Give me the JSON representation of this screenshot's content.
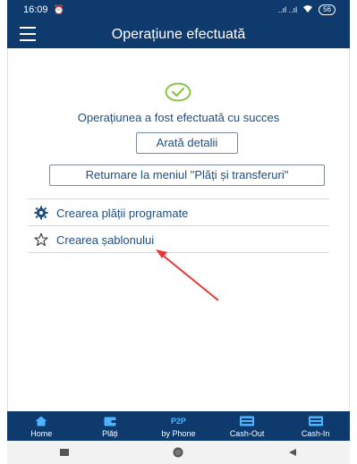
{
  "status_bar": {
    "time": "16:09",
    "alarm_icon": "alarm-icon",
    "signal": "..ıl ..ıl",
    "battery": "56"
  },
  "app_bar": {
    "title": "Operațiune efectuată",
    "menu_icon": "hamburger-menu-icon"
  },
  "main": {
    "success_message": "Operațiunea a fost efectuată cu succes",
    "details_button": "Arată detalii",
    "return_button": "Returnare la meniul \"Plăți și transferuri\"",
    "actions": [
      {
        "label": "Crearea plății programate",
        "icon": "gear-icon"
      },
      {
        "label": "Crearea șablonului",
        "icon": "star-outline-icon"
      }
    ]
  },
  "tabs": [
    {
      "label": "Home",
      "icon": "home-icon"
    },
    {
      "label": "Plăți",
      "icon": "wallet-icon"
    },
    {
      "top": "P2P",
      "label": "by Phone"
    },
    {
      "label": "Cash-Out",
      "icon": "cash-out-icon"
    },
    {
      "label": "Cash-In",
      "icon": "cash-in-icon"
    }
  ],
  "colors": {
    "primary": "#0e3a6e",
    "accent": "#1e4e86",
    "success": "#8bc34a",
    "annotation": "#e53935"
  }
}
